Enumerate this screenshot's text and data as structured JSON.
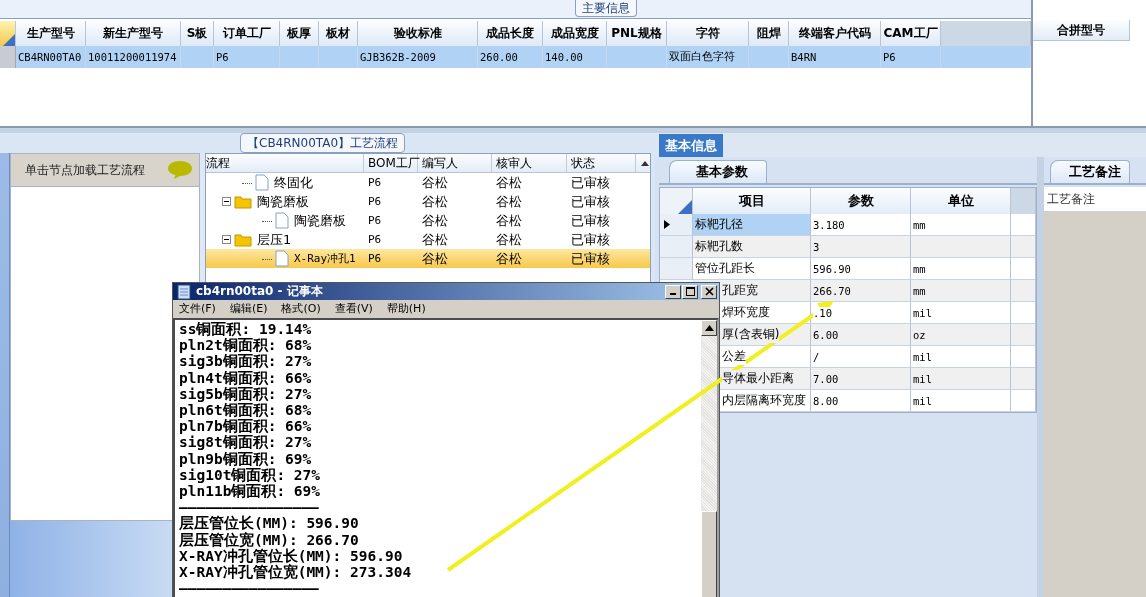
{
  "main_info": {
    "title": "主要信息",
    "columns": [
      "生产型号",
      "新生产型号",
      "S板",
      "订单工厂",
      "板厚",
      "板材",
      "验收标准",
      "成品长度",
      "成品宽度",
      "PNL规格",
      "字符",
      "阻焊",
      "终端客户代码",
      "CAM工厂"
    ],
    "rows": [
      {
        "selected": true,
        "cells": [
          "CB4RN00TA0",
          "10011200011974",
          null,
          "P6",
          null,
          null,
          "GJB362B-2009",
          "260.00",
          "140.00",
          null,
          "双面白色字符",
          null,
          "B4RN",
          "P6"
        ]
      }
    ]
  },
  "merge_panel": {
    "column": "合拼型号"
  },
  "flow_panel": {
    "title": "【CB4RN00TA0】工艺流程",
    "hint": "单击节点加载工艺流程",
    "columns": [
      "流程",
      "BOM工厂",
      "编写人",
      "核审人",
      "状态"
    ],
    "tree": [
      {
        "label": "终固化",
        "kind": "file",
        "selected": false,
        "bom": "P6",
        "author": "谷松",
        "reviewer": "谷松",
        "status": "已审核"
      },
      {
        "label": "陶瓷磨板",
        "kind": "folder",
        "expanded": true,
        "selected": false,
        "bom": "P6",
        "author": "谷松",
        "reviewer": "谷松",
        "status": "已审核",
        "children": [
          {
            "label": "陶瓷磨板",
            "kind": "file",
            "selected": false,
            "bom": "P6",
            "author": "谷松",
            "reviewer": "谷松",
            "status": "已审核"
          }
        ]
      },
      {
        "label": "层压1",
        "kind": "folder",
        "expanded": true,
        "selected": false,
        "bom": "P6",
        "author": "谷松",
        "reviewer": "谷松",
        "status": "已审核",
        "children": [
          {
            "label": "X-Ray冲孔1",
            "kind": "file",
            "selected": true,
            "bom": "P6",
            "author": "谷松",
            "reviewer": "谷松",
            "status": "已审核"
          }
        ]
      }
    ]
  },
  "info_tabs": [
    {
      "label": "基本信息",
      "selected": true
    }
  ],
  "param_tabs": [
    {
      "label": "基本参数",
      "selected": true
    }
  ],
  "params": {
    "columns": [
      "项目",
      "参数",
      "单位"
    ],
    "rows": [
      {
        "item": "标靶孔径",
        "value": "3.180",
        "unit": "mm",
        "selected": true,
        "partial": false
      },
      {
        "item": "标靶孔数",
        "value": "3",
        "unit": null,
        "selected": false,
        "partial": false
      },
      {
        "item": "管位孔距长",
        "value": "596.90",
        "unit": "mm",
        "selected": false,
        "partial": false
      },
      {
        "item": "孔距宽",
        "value": "266.70",
        "unit": "mm",
        "selected": false,
        "partial": true
      },
      {
        "item": "焊环宽度",
        "value": ".10",
        "unit": "mil",
        "selected": false,
        "partial": true
      },
      {
        "item": "厚(含表铜)",
        "value": "6.00",
        "unit": "oz",
        "selected": false,
        "partial": true
      },
      {
        "item": "公差",
        "value": "/",
        "unit": "mil",
        "selected": false,
        "partial": true
      },
      {
        "item": "导体最小距离",
        "value": "7.00",
        "unit": "mil",
        "selected": false,
        "partial": true
      },
      {
        "item": "内层隔离环宽度",
        "value": "8.00",
        "unit": "mil",
        "selected": false,
        "partial": true
      }
    ]
  },
  "remarks": {
    "tab": "工艺备注",
    "column": "工艺备注"
  },
  "notepad": {
    "title": "cb4rn00ta0 - 记事本",
    "menu": [
      "文件(F)",
      "编辑(E)",
      "格式(O)",
      "查看(V)",
      "帮助(H)"
    ],
    "lines": [
      "ss铜面积: 19.14%",
      "pln2t铜面积: 68%",
      "sig3b铜面积: 27%",
      "pln4t铜面积: 66%",
      "sig5b铜面积: 27%",
      "pln6t铜面积: 68%",
      "pln7b铜面积: 66%",
      "sig8t铜面积: 27%",
      "pln9b铜面积: 69%",
      "sig10t铜面积: 27%",
      "pln11b铜面积: 69%",
      "————————————————",
      "层压管位长(MM): 596.90",
      "层压管位宽(MM): 266.70",
      "X-RAY冲孔管位长(MM): 596.90",
      "X-RAY冲孔管位宽(MM): 273.304",
      "————————————————"
    ]
  }
}
